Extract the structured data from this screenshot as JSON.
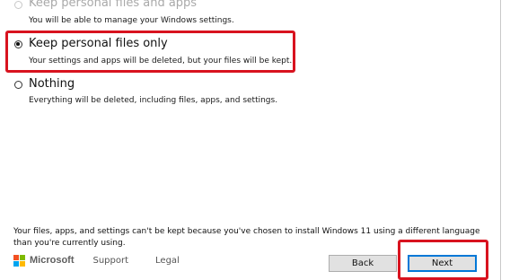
{
  "options": [
    {
      "label": "Keep personal files and apps",
      "description": "You will be able to manage your Windows settings.",
      "selected": false,
      "enabled": false
    },
    {
      "label": "Keep personal files only",
      "description": "Your settings and apps will be deleted, but your files will be kept.",
      "selected": true,
      "enabled": true
    },
    {
      "label": "Nothing",
      "description": "Everything will be deleted, including files, apps, and settings.",
      "selected": false,
      "enabled": true
    }
  ],
  "footer": {
    "note": "Your files, apps, and settings can't be kept because you've chosen to install  Windows 11 using a different language than you're currently using.",
    "brand": "Microsoft",
    "support_label": "Support",
    "legal_label": "Legal",
    "logo_colors": [
      "#f25022",
      "#7fba00",
      "#00a4ef",
      "#ffb900"
    ]
  },
  "buttons": {
    "back_label": "Back",
    "next_label": "Next"
  },
  "colors": {
    "highlight": "#d8131f",
    "focus": "#0078d7"
  }
}
